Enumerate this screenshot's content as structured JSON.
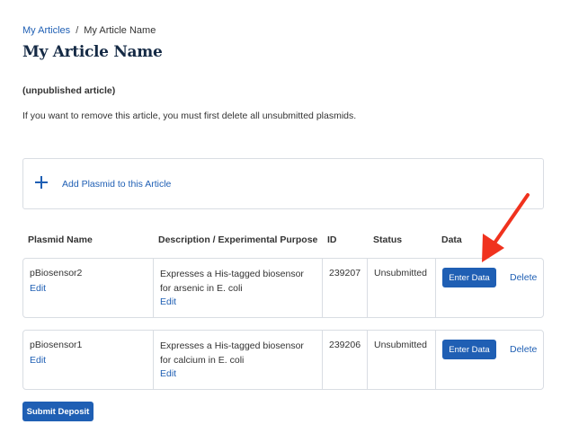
{
  "breadcrumb": {
    "parent": "My Articles",
    "separator": "/",
    "current": "My Article Name"
  },
  "page_title": "My Article Name",
  "status_note": "(unpublished article)",
  "info_text": "If you want to remove this article, you must first delete all unsubmitted plasmids.",
  "add_panel": {
    "label": "Add Plasmid to this Article",
    "icon": "plus-icon"
  },
  "table": {
    "headers": {
      "name": "Plasmid Name",
      "description": "Description / Experimental Purpose",
      "id": "ID",
      "status": "Status",
      "data": "Data"
    },
    "rows": [
      {
        "name": "pBiosensor2",
        "edit": "Edit",
        "description": "Expresses a His-tagged biosensor for arsenic in E. coli",
        "description_edit": "Edit",
        "id": "239207",
        "status": "Unsubmitted",
        "enter_data": "Enter Data",
        "delete": "Delete"
      },
      {
        "name": "pBiosensor1",
        "edit": "Edit",
        "description": "Expresses a His-tagged biosensor for calcium in E. coli",
        "description_edit": "Edit",
        "id": "239206",
        "status": "Unsubmitted",
        "enter_data": "Enter Data",
        "delete": "Delete"
      }
    ]
  },
  "submit_label": "Submit Deposit",
  "colors": {
    "accent": "#1f5fb4",
    "title": "#152a45",
    "annotation_arrow": "#f0321e",
    "border": "#d9dde3"
  }
}
